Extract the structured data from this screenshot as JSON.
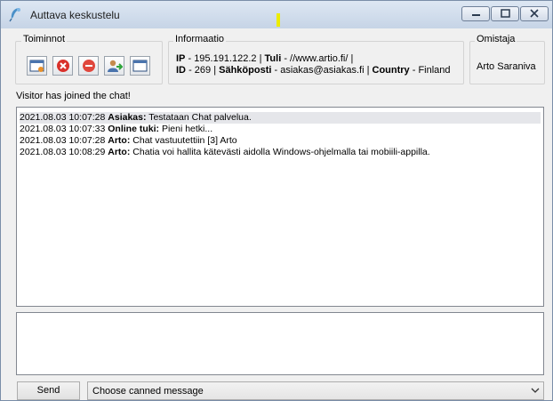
{
  "window": {
    "title": "Auttava keskustelu",
    "accent_color": "#c6d4e6"
  },
  "toolbar": {
    "title": "Toiminnot",
    "buttons": [
      {
        "icon": "window-edit-icon"
      },
      {
        "icon": "close-red-icon"
      },
      {
        "icon": "block-icon"
      },
      {
        "icon": "user-transfer-icon"
      },
      {
        "icon": "window-icon"
      }
    ]
  },
  "info": {
    "title": "Informaatio",
    "ip_label": "IP",
    "ip_value": "- 195.191.122.2 |",
    "source_label": "Tuli",
    "source_value": "- //www.artio.fi/ |",
    "id_label": "ID",
    "id_value": "- 269 |",
    "email_label": "Sähköposti",
    "email_value": "- asiakas@asiakas.fi |",
    "country_label": "Country",
    "country_value": "- Finland"
  },
  "owner": {
    "title": "Omistaja",
    "name": "Arto Saraniva"
  },
  "status_text": "Visitor has joined the chat!",
  "messages": [
    {
      "timestamp": "2021.08.03 10:07:28",
      "sender": "Asiakas:",
      "text": "Testataan Chat palvelua."
    },
    {
      "timestamp": "2021.08.03 10:07:33",
      "sender": "Online tuki:",
      "text": "Pieni hetki..."
    },
    {
      "timestamp": "2021.08.03 10:07:28",
      "sender": "Arto:",
      "text": "Chat vastuutettiin [3] Arto"
    },
    {
      "timestamp": "2021.08.03 10:08:29",
      "sender": "Arto:",
      "text": "Chatia voi hallita kätevästi aidolla Windows-ohjelmalla tai mobiili-appilla."
    }
  ],
  "compose": {
    "value": "",
    "send_label": "Send",
    "canned_selected": "Choose canned message"
  }
}
